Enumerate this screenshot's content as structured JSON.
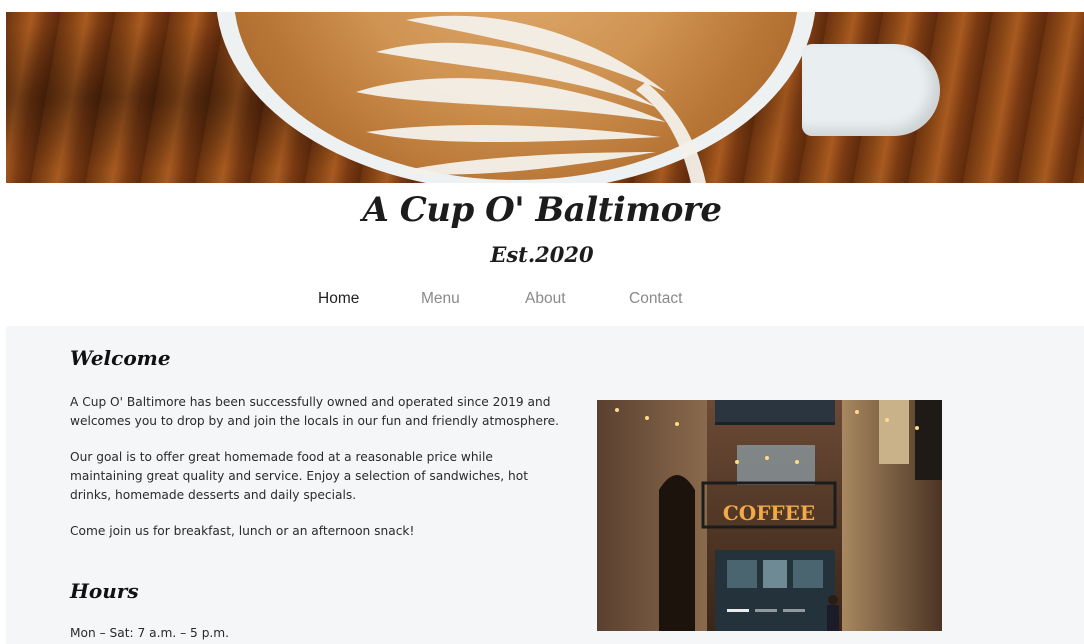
{
  "header": {
    "title": "A Cup O' Baltimore",
    "est": "Est.2020"
  },
  "nav": {
    "items": [
      {
        "label": "Home",
        "active": true
      },
      {
        "label": "Menu",
        "active": false
      },
      {
        "label": "About",
        "active": false
      },
      {
        "label": "Contact",
        "active": false
      }
    ]
  },
  "welcome": {
    "heading": "Welcome",
    "p1": "A Cup O' Baltimore has been successfully owned and operated since 2019 and welcomes you to drop by and join the locals in our fun and friendly atmosphere.",
    "p2": "Our goal is to offer great homemade food at a reasonable price while maintaining great quality and service. Enjoy a selection of sandwiches, hot drinks, homemade desserts and daily specials.",
    "p3": "Come join us for breakfast, lunch or an afternoon snack!"
  },
  "hours": {
    "heading": "Hours",
    "line1": "Mon – Sat: 7 a.m. – 5 p.m."
  },
  "photo": {
    "sign_text": "COFFEE"
  },
  "colors": {
    "accent_text": "#1c1c1c",
    "nav_inactive": "#8a8a8a",
    "content_bg": "#f5f6f8"
  }
}
